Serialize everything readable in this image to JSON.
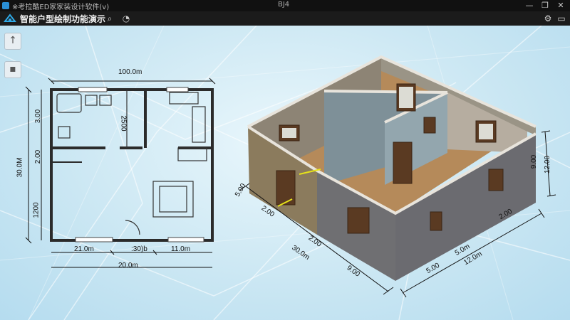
{
  "window": {
    "title": "※考拉酷ED家家装设计软件(v)",
    "center_text": "BJ4"
  },
  "toolbar": {
    "app_title": "智能户型绘制功能演示"
  },
  "plan_dims": {
    "top_total": "100.0m",
    "bottom_total": "20.0m",
    "bottom_left": "21.0m",
    "bottom_mid": ":30)b",
    "bottom_right": "11.0m",
    "left_total": "30.0M",
    "left_seg1": "3.00",
    "left_seg2": "2.00",
    "left_seg3": "1200",
    "inner_vertical": "2500"
  },
  "model_dims": {
    "front_a": "5.00",
    "front_b": "2.00",
    "front_c": "2.00",
    "front_d": "30.0m",
    "front_e": "9.00",
    "right_a": "5.00",
    "right_b": "5.0m",
    "right_c": "12.0m",
    "right_d": "2.00",
    "side_a": "9.00",
    "side_b": "12.00"
  }
}
